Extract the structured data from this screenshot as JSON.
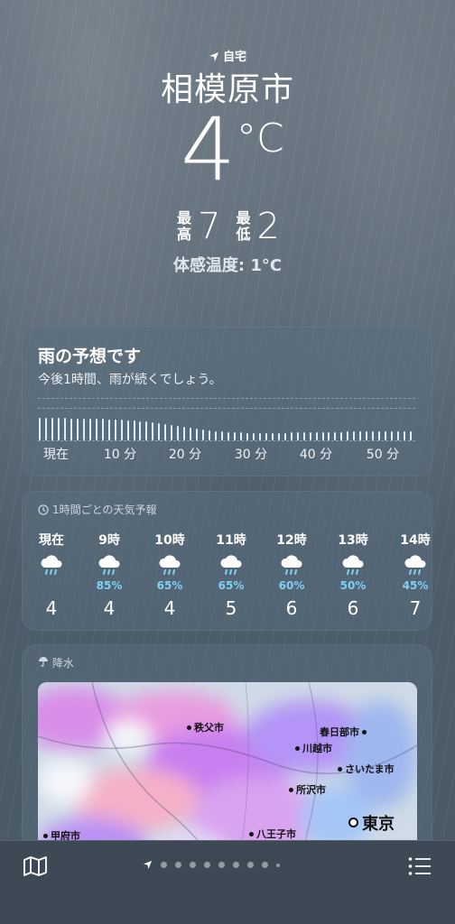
{
  "location": {
    "label": "自宅",
    "city": "相模原市"
  },
  "current": {
    "temp": "4",
    "unit": "°C",
    "high_label": "最高",
    "high": "7",
    "low_label": "最低",
    "low": "2",
    "feels_like": "体感温度: 1°C"
  },
  "precip_forecast": {
    "title": "雨の予想です",
    "subtitle": "今後1時間、雨が続くでしょう。",
    "minute_labels": [
      "現在",
      "10 分",
      "20 分",
      "30 分",
      "40 分",
      "50 分"
    ],
    "intensity": [
      1.0,
      1.0,
      1.0,
      1.0,
      1.0,
      0.98,
      0.98,
      0.97,
      0.96,
      0.95,
      0.95,
      0.94,
      0.93,
      0.92,
      0.9,
      0.88,
      0.86,
      0.84,
      0.8,
      0.76,
      0.72,
      0.68,
      0.64,
      0.6,
      0.56,
      0.52,
      0.48,
      0.45,
      0.42,
      0.4,
      0.38,
      0.36,
      0.35,
      0.34,
      0.34,
      0.34,
      0.34,
      0.34,
      0.34,
      0.34,
      0.35,
      0.35,
      0.36,
      0.36,
      0.37,
      0.37,
      0.38,
      0.38,
      0.38,
      0.39,
      0.39,
      0.4,
      0.4,
      0.4,
      0.4,
      0.41,
      0.41,
      0.42,
      0.42,
      0.42
    ]
  },
  "hourly": {
    "header": "1時間ごとの天気予報",
    "items": [
      {
        "time": "現在",
        "icon": "rain-cloud-icon",
        "precip": "",
        "temp": "4"
      },
      {
        "time": "9時",
        "icon": "rain-cloud-icon",
        "precip": "85%",
        "temp": "4"
      },
      {
        "time": "10時",
        "icon": "rain-cloud-icon",
        "precip": "65%",
        "temp": "4"
      },
      {
        "time": "11時",
        "icon": "rain-cloud-icon",
        "precip": "65%",
        "temp": "5"
      },
      {
        "time": "12時",
        "icon": "rain-cloud-icon",
        "precip": "60%",
        "temp": "6"
      },
      {
        "time": "13時",
        "icon": "rain-cloud-icon",
        "precip": "50%",
        "temp": "6"
      },
      {
        "time": "14時",
        "icon": "rain-cloud-icon",
        "precip": "45%",
        "temp": "7"
      }
    ]
  },
  "precip_map": {
    "header": "降水",
    "towns": [
      "秩父市",
      "春日部市",
      "川越市",
      "さいたま市",
      "所沢市",
      "東京",
      "八王子市",
      "甲府市"
    ]
  },
  "colors": {
    "accent_precip": "#7fd0f5",
    "bar": "#d9eefe",
    "bottom_bar": "#3d4954"
  }
}
